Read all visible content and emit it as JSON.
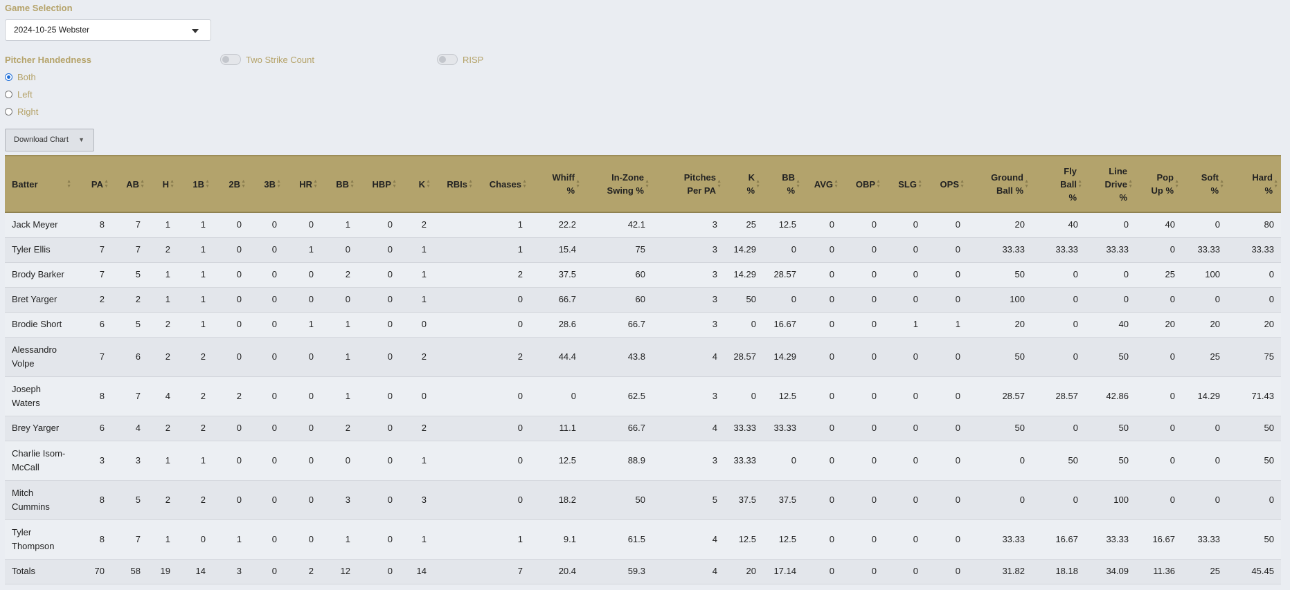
{
  "game": {
    "label": "Game Selection",
    "selected": "2024-10-25 Webster"
  },
  "handedness": {
    "label": "Pitcher Handedness",
    "options": [
      "Both",
      "Left",
      "Right"
    ],
    "selected": "Both"
  },
  "toggles": {
    "two_strike": "Two Strike Count",
    "risp": "RISP"
  },
  "download": {
    "label": "Download Chart"
  },
  "table": {
    "headers": [
      "Batter",
      "PA",
      "AB",
      "H",
      "1B",
      "2B",
      "3B",
      "HR",
      "BB",
      "HBP",
      "K",
      "RBIs",
      "Chases",
      "Whiff %",
      "In-Zone Swing %",
      "Pitches Per PA",
      "K %",
      "BB %",
      "AVG",
      "OBP",
      "SLG",
      "OPS",
      "Ground Ball %",
      "Fly Ball %",
      "Line Drive %",
      "Pop Up %",
      "Soft %",
      "Hard %"
    ],
    "rows": [
      [
        "Jack Meyer",
        "8",
        "7",
        "1",
        "1",
        "0",
        "0",
        "0",
        "1",
        "0",
        "2",
        "",
        "1",
        "22.2",
        "42.1",
        "3",
        "25",
        "12.5",
        "0",
        "0",
        "0",
        "0",
        "20",
        "40",
        "0",
        "40",
        "0",
        "80"
      ],
      [
        "Tyler Ellis",
        "7",
        "7",
        "2",
        "1",
        "0",
        "0",
        "1",
        "0",
        "0",
        "1",
        "",
        "1",
        "15.4",
        "75",
        "3",
        "14.29",
        "0",
        "0",
        "0",
        "0",
        "0",
        "33.33",
        "33.33",
        "33.33",
        "0",
        "33.33",
        "33.33"
      ],
      [
        "Brody Barker",
        "7",
        "5",
        "1",
        "1",
        "0",
        "0",
        "0",
        "2",
        "0",
        "1",
        "",
        "2",
        "37.5",
        "60",
        "3",
        "14.29",
        "28.57",
        "0",
        "0",
        "0",
        "0",
        "50",
        "0",
        "0",
        "25",
        "100",
        "0"
      ],
      [
        "Bret Yarger",
        "2",
        "2",
        "1",
        "1",
        "0",
        "0",
        "0",
        "0",
        "0",
        "1",
        "",
        "0",
        "66.7",
        "60",
        "3",
        "50",
        "0",
        "0",
        "0",
        "0",
        "0",
        "100",
        "0",
        "0",
        "0",
        "0",
        "0"
      ],
      [
        "Brodie Short",
        "6",
        "5",
        "2",
        "1",
        "0",
        "0",
        "1",
        "1",
        "0",
        "0",
        "",
        "0",
        "28.6",
        "66.7",
        "3",
        "0",
        "16.67",
        "0",
        "0",
        "1",
        "1",
        "20",
        "0",
        "40",
        "20",
        "20",
        "20"
      ],
      [
        "Alessandro Volpe",
        "7",
        "6",
        "2",
        "2",
        "0",
        "0",
        "0",
        "1",
        "0",
        "2",
        "",
        "2",
        "44.4",
        "43.8",
        "4",
        "28.57",
        "14.29",
        "0",
        "0",
        "0",
        "0",
        "50",
        "0",
        "50",
        "0",
        "25",
        "75"
      ],
      [
        "Joseph Waters",
        "8",
        "7",
        "4",
        "2",
        "2",
        "0",
        "0",
        "1",
        "0",
        "0",
        "",
        "0",
        "0",
        "62.5",
        "3",
        "0",
        "12.5",
        "0",
        "0",
        "0",
        "0",
        "28.57",
        "28.57",
        "42.86",
        "0",
        "14.29",
        "71.43"
      ],
      [
        "Brey Yarger",
        "6",
        "4",
        "2",
        "2",
        "0",
        "0",
        "0",
        "2",
        "0",
        "2",
        "",
        "0",
        "11.1",
        "66.7",
        "4",
        "33.33",
        "33.33",
        "0",
        "0",
        "0",
        "0",
        "50",
        "0",
        "50",
        "0",
        "0",
        "50"
      ],
      [
        "Charlie Isom-McCall",
        "3",
        "3",
        "1",
        "1",
        "0",
        "0",
        "0",
        "0",
        "0",
        "1",
        "",
        "0",
        "12.5",
        "88.9",
        "3",
        "33.33",
        "0",
        "0",
        "0",
        "0",
        "0",
        "0",
        "50",
        "50",
        "0",
        "0",
        "50"
      ],
      [
        "Mitch Cummins",
        "8",
        "5",
        "2",
        "2",
        "0",
        "0",
        "0",
        "3",
        "0",
        "3",
        "",
        "0",
        "18.2",
        "50",
        "5",
        "37.5",
        "37.5",
        "0",
        "0",
        "0",
        "0",
        "0",
        "0",
        "100",
        "0",
        "0",
        "0"
      ],
      [
        "Tyler Thompson",
        "8",
        "7",
        "1",
        "0",
        "1",
        "0",
        "0",
        "1",
        "0",
        "1",
        "",
        "1",
        "9.1",
        "61.5",
        "4",
        "12.5",
        "12.5",
        "0",
        "0",
        "0",
        "0",
        "33.33",
        "16.67",
        "33.33",
        "16.67",
        "33.33",
        "50"
      ],
      [
        "Totals",
        "70",
        "58",
        "19",
        "14",
        "3",
        "0",
        "2",
        "12",
        "0",
        "14",
        "",
        "7",
        "20.4",
        "59.3",
        "4",
        "20",
        "17.14",
        "0",
        "0",
        "0",
        "0",
        "31.82",
        "18.18",
        "34.09",
        "11.36",
        "25",
        "45.45"
      ]
    ]
  }
}
